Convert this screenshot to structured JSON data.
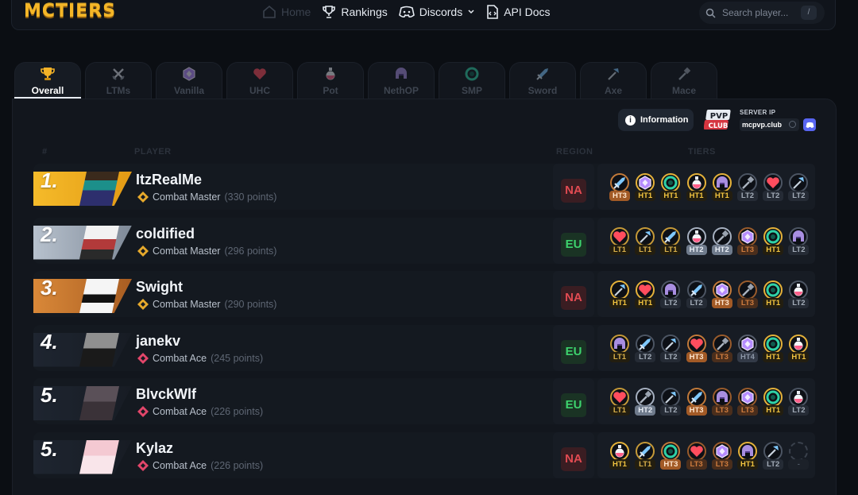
{
  "brand": {
    "logo": "MCTIERS"
  },
  "nav": {
    "home": "Home",
    "rankings": "Rankings",
    "discords": "Discords",
    "api_docs": "API Docs"
  },
  "search": {
    "placeholder": "Search player...",
    "shortcut": "/"
  },
  "tabs": [
    {
      "label": "Overall",
      "icon": "trophy-icon"
    },
    {
      "label": "LTMs",
      "icon": "crossed-swords-icon"
    },
    {
      "label": "Vanilla",
      "icon": "vanilla-crystal-icon"
    },
    {
      "label": "UHC",
      "icon": "heart-icon"
    },
    {
      "label": "Pot",
      "icon": "potion-icon"
    },
    {
      "label": "NethOP",
      "icon": "netherite-helmet-icon"
    },
    {
      "label": "SMP",
      "icon": "ender-pearl-icon"
    },
    {
      "label": "Sword",
      "icon": "sword-icon"
    },
    {
      "label": "Axe",
      "icon": "axe-icon"
    },
    {
      "label": "Mace",
      "icon": "mace-icon"
    }
  ],
  "info": {
    "button": "Information",
    "server_label": "SERVER IP",
    "server_ip": "mcpvp.club",
    "server_logo_top": "PVP",
    "server_logo_bottom": "CLUB"
  },
  "columns": {
    "rank": "#",
    "player": "PLAYER",
    "region": "REGION",
    "tiers": "TIERS"
  },
  "colors": {
    "gold": "#f3b227",
    "silver": "#9ea9b8",
    "bronze": "#c8742e",
    "na": "#e14b52",
    "eu": "#3dd26d"
  },
  "players": [
    {
      "rank": "1.",
      "name": "ItzRealMe",
      "title": "Combat Master",
      "points": "(330 points)",
      "region": "NA",
      "tiers": [
        {
          "icon": "sword-icon",
          "tier": "HT3"
        },
        {
          "icon": "vanilla-crystal-icon",
          "tier": "HT1"
        },
        {
          "icon": "ender-pearl-icon",
          "tier": "HT1"
        },
        {
          "icon": "potion-icon",
          "tier": "HT1"
        },
        {
          "icon": "netherite-helmet-icon",
          "tier": "HT1"
        },
        {
          "icon": "mace-icon",
          "tier": "LT2"
        },
        {
          "icon": "heart-icon",
          "tier": "LT2"
        },
        {
          "icon": "axe-icon",
          "tier": "LT2"
        }
      ]
    },
    {
      "rank": "2.",
      "name": "coldified",
      "title": "Combat Master",
      "points": "(296 points)",
      "region": "EU",
      "tiers": [
        {
          "icon": "heart-icon",
          "tier": "LT1"
        },
        {
          "icon": "axe-icon",
          "tier": "LT1"
        },
        {
          "icon": "sword-icon",
          "tier": "LT1"
        },
        {
          "icon": "potion-icon",
          "tier": "HT2"
        },
        {
          "icon": "mace-icon",
          "tier": "HT2"
        },
        {
          "icon": "vanilla-crystal-icon",
          "tier": "LT3"
        },
        {
          "icon": "ender-pearl-icon",
          "tier": "HT1"
        },
        {
          "icon": "netherite-helmet-icon",
          "tier": "LT2"
        }
      ]
    },
    {
      "rank": "3.",
      "name": "Swight",
      "title": "Combat Master",
      "points": "(290 points)",
      "region": "NA",
      "tiers": [
        {
          "icon": "axe-icon",
          "tier": "HT1"
        },
        {
          "icon": "heart-icon",
          "tier": "HT1"
        },
        {
          "icon": "netherite-helmet-icon",
          "tier": "LT2"
        },
        {
          "icon": "sword-icon",
          "tier": "LT2"
        },
        {
          "icon": "vanilla-crystal-icon",
          "tier": "HT3"
        },
        {
          "icon": "mace-icon",
          "tier": "LT3"
        },
        {
          "icon": "ender-pearl-icon",
          "tier": "HT1"
        },
        {
          "icon": "potion-icon",
          "tier": "LT2"
        }
      ]
    },
    {
      "rank": "4.",
      "name": "janekv",
      "title": "Combat Ace",
      "points": "(245 points)",
      "region": "EU",
      "tiers": [
        {
          "icon": "netherite-helmet-icon",
          "tier": "LT1"
        },
        {
          "icon": "sword-icon",
          "tier": "LT2"
        },
        {
          "icon": "axe-icon",
          "tier": "LT2"
        },
        {
          "icon": "heart-icon",
          "tier": "HT3"
        },
        {
          "icon": "mace-icon",
          "tier": "LT3"
        },
        {
          "icon": "vanilla-crystal-icon",
          "tier": "HT4"
        },
        {
          "icon": "ender-pearl-icon",
          "tier": "HT1"
        },
        {
          "icon": "potion-icon",
          "tier": "HT1"
        }
      ]
    },
    {
      "rank": "5.",
      "name": "BlvckWlf",
      "title": "Combat Ace",
      "points": "(226 points)",
      "region": "EU",
      "tiers": [
        {
          "icon": "heart-icon",
          "tier": "LT1"
        },
        {
          "icon": "mace-icon",
          "tier": "HT2"
        },
        {
          "icon": "axe-icon",
          "tier": "LT2"
        },
        {
          "icon": "sword-icon",
          "tier": "HT3"
        },
        {
          "icon": "netherite-helmet-icon",
          "tier": "LT3"
        },
        {
          "icon": "vanilla-crystal-icon",
          "tier": "LT3"
        },
        {
          "icon": "ender-pearl-icon",
          "tier": "HT1"
        },
        {
          "icon": "potion-icon",
          "tier": "LT2"
        }
      ]
    },
    {
      "rank": "5.",
      "name": "Kylaz",
      "title": "Combat Ace",
      "points": "(226 points)",
      "region": "NA",
      "tiers": [
        {
          "icon": "potion-icon",
          "tier": "HT1"
        },
        {
          "icon": "sword-icon",
          "tier": "LT1"
        },
        {
          "icon": "ender-pearl-icon",
          "tier": "HT3"
        },
        {
          "icon": "heart-icon",
          "tier": "LT3"
        },
        {
          "icon": "vanilla-crystal-icon",
          "tier": "LT3"
        },
        {
          "icon": "netherite-helmet-icon",
          "tier": "HT1"
        },
        {
          "icon": "axe-icon",
          "tier": "LT2"
        },
        {
          "icon": "empty-slot-icon",
          "tier": "-"
        }
      ]
    }
  ]
}
